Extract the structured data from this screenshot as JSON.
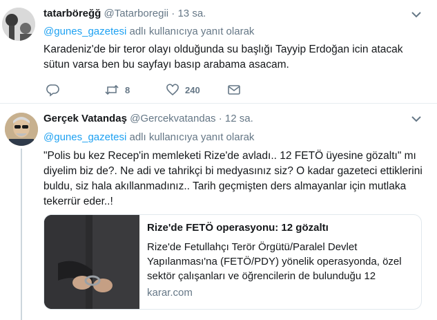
{
  "tweets": [
    {
      "name": "tatarböreğğ",
      "handle": "@Tatarboregii",
      "separator": "·",
      "time": "13 sa.",
      "reply_prefix": "@gunes_gazetesi",
      "reply_suffix": " adlı kullanıcıya yanıt olarak",
      "text": "Karadeniz'de bir teror olayı olduğunda su başlığı Tayyip Erdoğan icin atacak sütun varsa ben bu sayfayı basıp arabama asacam.",
      "actions": {
        "reply_icon": "reply-icon",
        "retweet_icon": "retweet-icon",
        "retweet_count": "8",
        "like_icon": "heart-icon",
        "like_count": "240",
        "dm_icon": "envelope-icon"
      }
    },
    {
      "name": "Gerçek Vatandaş",
      "handle": "@Gercekvatandas",
      "separator": "·",
      "time": "12 sa.",
      "reply_prefix": "@gunes_gazetesi",
      "reply_suffix": " adlı kullanıcıya yanıt olarak",
      "text": "\"Polis bu kez Recep'in memleketi Rize'de avladı.. 12 FETÖ üyesine gözaltı\" mı diyelim biz de?. Ne adi ve tahrikçi bi medyasınız siz? O kadar gazeteci ettiklerini buldu, siz hala akıllanmadınız.. Tarih geçmişten ders almayanlar için mutlaka tekerrür eder..!",
      "card": {
        "title": "Rize'de FETÖ operasyonu: 12 gözaltı",
        "description": "Rize'de Fetullahçı Terör Örgütü/Paralel Devlet Yapılanması'na (FETÖ/PDY) yönelik operasyonda, özel sektör çalışanları ve öğrencilerin de bulunduğu 12",
        "domain": "karar.com"
      }
    }
  ],
  "colors": {
    "link": "#1da1f2",
    "secondary_text": "#657786",
    "primary_text": "#14171a",
    "border": "#e6ecf0"
  }
}
